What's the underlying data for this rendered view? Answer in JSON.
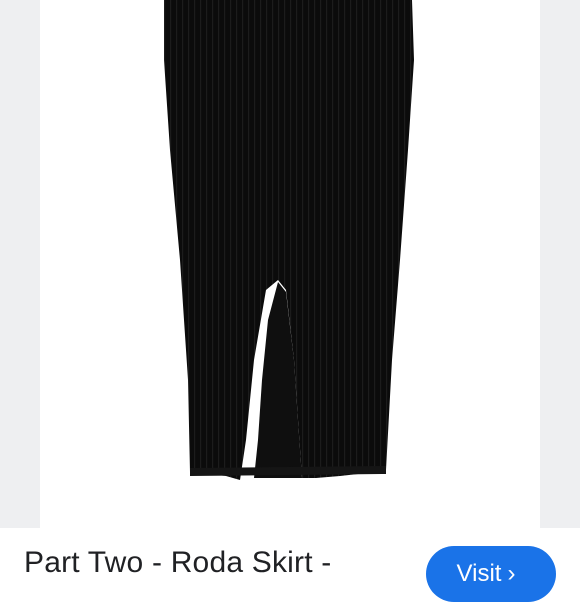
{
  "product": {
    "title": "Part Two - Roda Skirt -",
    "image_description_icon": "skirt-image"
  },
  "actions": {
    "visit_label": "Visit",
    "visit_chevron": "›"
  },
  "colors": {
    "background": "#eeeff1",
    "frame": "#ffffff",
    "garment": "#0b0b0b",
    "accent": "#1a73e8",
    "title_text": "#202124"
  }
}
